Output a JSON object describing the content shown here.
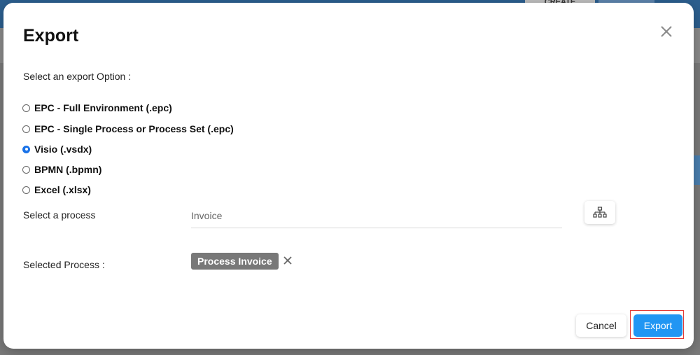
{
  "background": {
    "create_label": "CREATE"
  },
  "dialog": {
    "title": "Export",
    "prompt": "Select an export Option :",
    "options": [
      {
        "label": "EPC - Full Environment (.epc)",
        "checked": false
      },
      {
        "label": "EPC - Single Process or Process Set (.epc)",
        "checked": false
      },
      {
        "label": "Visio (.vsdx)",
        "checked": true
      },
      {
        "label": "BPMN (.bpmn)",
        "checked": false
      },
      {
        "label": "Excel (.xlsx)",
        "checked": false
      }
    ],
    "select_process_label": "Select a process",
    "process_input_placeholder": "Invoice",
    "selected_process_label": "Selected Process :",
    "selected_process_chip": "Process Invoice",
    "cancel_label": "Cancel",
    "export_label": "Export"
  },
  "colors": {
    "accent": "#2196f3",
    "highlight_outline": "#e53935",
    "chip_bg": "#787878"
  },
  "icons": {
    "close": "close-icon",
    "hierarchy": "hierarchy-tree-icon",
    "remove_chip": "remove-icon"
  }
}
